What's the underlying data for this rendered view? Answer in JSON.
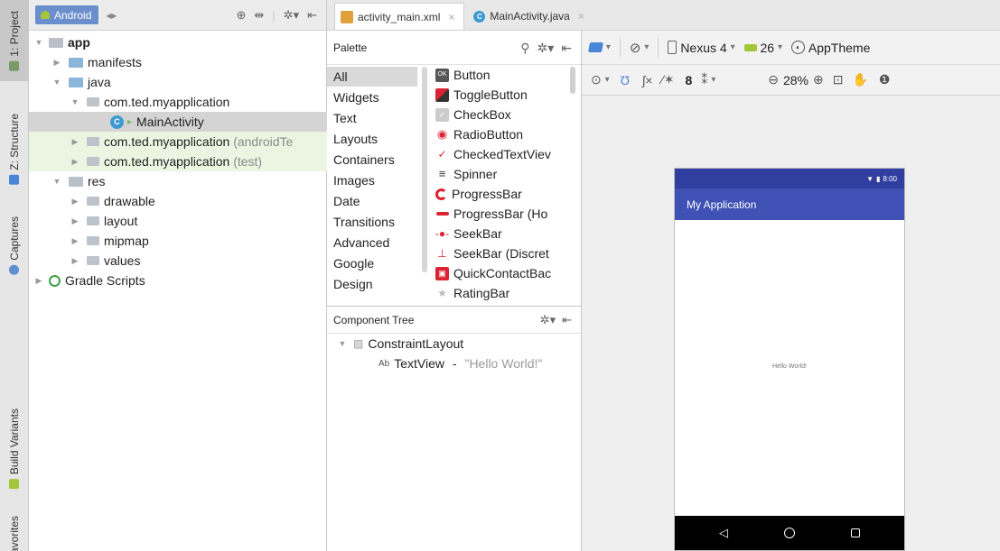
{
  "sidebar": {
    "tabs": {
      "project": "1: Project",
      "structure": "Z: Structure",
      "captures": "Captures",
      "build_variants": "Build Variants",
      "favorites": "Favorites"
    }
  },
  "project": {
    "view_mode": "Android",
    "tree": [
      {
        "label": "app",
        "suffix": ""
      },
      {
        "label": "manifests",
        "suffix": ""
      },
      {
        "label": "java",
        "suffix": ""
      },
      {
        "label": "com.ted.myapplication",
        "suffix": ""
      },
      {
        "label": "MainActivity",
        "suffix": ""
      },
      {
        "label": "com.ted.myapplication",
        "suffix": "(androidTe"
      },
      {
        "label": "com.ted.myapplication",
        "suffix": "(test)"
      },
      {
        "label": "res",
        "suffix": ""
      },
      {
        "label": "drawable",
        "suffix": ""
      },
      {
        "label": "layout",
        "suffix": ""
      },
      {
        "label": "mipmap",
        "suffix": ""
      },
      {
        "label": "values",
        "suffix": ""
      },
      {
        "label": "Gradle Scripts",
        "suffix": ""
      }
    ]
  },
  "editor": {
    "tabs": [
      {
        "label": "activity_main.xml",
        "close": "×"
      },
      {
        "label": "MainActivity.java",
        "close": "×"
      }
    ]
  },
  "palette": {
    "title": "Palette",
    "categories": [
      "All",
      "Widgets",
      "Text",
      "Layouts",
      "Containers",
      "Images",
      "Date",
      "Transitions",
      "Advanced",
      "Google",
      "Design"
    ],
    "widgets": [
      {
        "label": "Button",
        "icon": "ok-button-icon"
      },
      {
        "label": "ToggleButton",
        "icon": "toggle-button-icon"
      },
      {
        "label": "CheckBox",
        "icon": "checkbox-icon"
      },
      {
        "label": "RadioButton",
        "icon": "radio-button-icon"
      },
      {
        "label": "CheckedTextViev",
        "icon": "checked-text-view-icon"
      },
      {
        "label": "Spinner",
        "icon": "spinner-icon"
      },
      {
        "label": "ProgressBar",
        "icon": "progress-bar-icon"
      },
      {
        "label": "ProgressBar (Ho",
        "icon": "progress-bar-horizontal-icon"
      },
      {
        "label": "SeekBar",
        "icon": "seekbar-icon"
      },
      {
        "label": "SeekBar (Discret",
        "icon": "seekbar-discrete-icon"
      },
      {
        "label": "QuickContactBac",
        "icon": "quick-contact-badge-icon"
      },
      {
        "label": "RatingBar",
        "icon": "rating-bar-icon"
      }
    ]
  },
  "component_tree": {
    "title": "Component Tree",
    "root": "ConstraintLayout",
    "child_prefix": "Ab",
    "child": "TextView",
    "child_sep": " - ",
    "child_text": "\"Hello World!\""
  },
  "design_toolbar": {
    "device": "Nexus 4",
    "api": "26",
    "theme": "AppTheme",
    "margin": "8",
    "zoom": "28%"
  },
  "device_preview": {
    "clock": "8:00",
    "app_title": "My Application",
    "text": "Hello World!"
  },
  "colors": {
    "accent": "#3f51b5",
    "status_bar": "#303f9f",
    "android_pill": "#6a8fcc"
  }
}
